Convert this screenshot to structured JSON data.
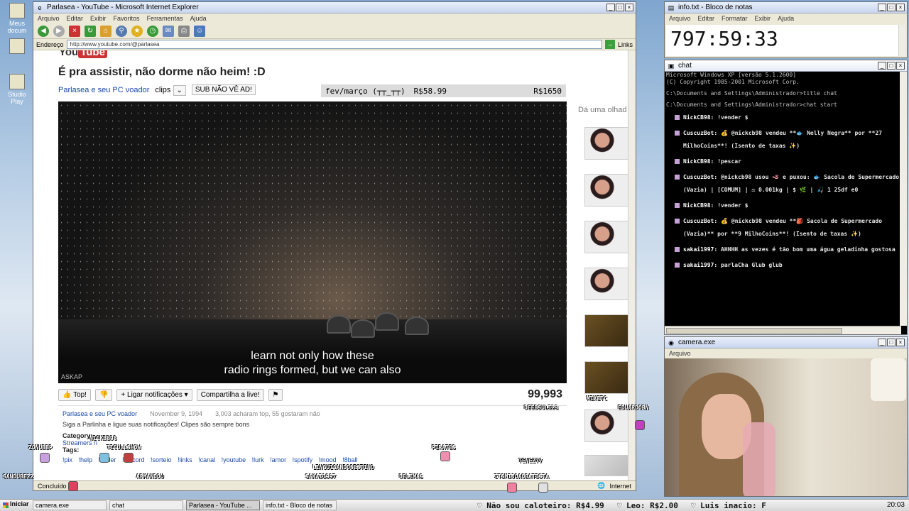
{
  "desktop": {
    "icons": [
      {
        "label": "Meus docum",
        "icon": "folder-icon"
      },
      {
        "label": "",
        "icon": "recycle-bin-icon"
      },
      {
        "label": "Studio Play",
        "icon": "app-icon"
      }
    ]
  },
  "ie": {
    "title": "Parlasea - YouTube - Microsoft Internet Explorer",
    "menu": [
      "Arquivo",
      "Editar",
      "Exibir",
      "Favoritos",
      "Ferramentas",
      "Ajuda"
    ],
    "address_label": "Endereço",
    "address": "http://www.youtube.com/@parlasea",
    "links_label": "Links",
    "status": {
      "left": "Concluído",
      "right": "Internet"
    }
  },
  "youtube": {
    "logo_a": "You",
    "logo_b": "Tube",
    "video_title": "É pra assistir, não dorme não heim! :D",
    "channel": "Parlasea e seu PC voador",
    "clips_label": "clips",
    "sub_label": "SUB NÃO VÊ AD!",
    "price_banner": {
      "label": "fev/março (┬┬_┬┬)",
      "price1": "R$58.99",
      "price2": "R$1650"
    },
    "caption_line1": "learn not only how these",
    "caption_line2": "radio rings formed, but we can also",
    "watermark": "ASKAP",
    "actions": {
      "like": "Top!",
      "notify": "Ligar notificações",
      "share": "Compartilha a live!"
    },
    "views": "99,993",
    "desc": {
      "channel": "Parlasea e seu PC voador",
      "date": "November 9, 1994",
      "likes": "3,003 acharam top, 55 gostaram não",
      "text": "Siga a Parlinha e ligue suas notificações! Clipes são sempre bons",
      "category_label": "Category:",
      "category_value": "Streamers n",
      "tags_label": "Tags:",
      "tags": "!pix !help !tinder !discord !sorteio !links !canal !youtube !lurk !amor !spotify !mood !8ball"
    },
    "related_title": "Dá uma olhad"
  },
  "overlay_names": [
    "ZONUBBP",
    "NICKBB98",
    "TICULLSHOW",
    "SANDUBE22",
    "ARMANDOU",
    "SAKAI1997",
    "LINGUICANDOSESTINO",
    "DELIMAS",
    "ITSMIJOAOBATISTA",
    "PIRATES",
    "TENEZ77",
    "DEEBSULI23",
    "MIXETC",
    "EDUARDOBN"
  ],
  "notepad": {
    "title": "info.txt - Bloco de notas",
    "menu": [
      "Arquivo",
      "Editar",
      "Formatar",
      "Exibir",
      "Ajuda"
    ],
    "content": "797:59:33"
  },
  "chat": {
    "title": "chat",
    "header_lines": [
      "Microsoft Windows XP [versão 5.1.2600]",
      "(C) Copyright 1985-2001 Microsoft Corp.",
      "C:\\Documents and Settings\\Administrador>title chat",
      "C:\\Documents and Settings\\Administrador>chat start"
    ],
    "messages": [
      {
        "user": "NickCB98:",
        "text": "!vender $"
      },
      {
        "user": "CuscuzBot:",
        "text": "💰 @nickcb98 vendeu **🐟 Nelly Negra** por **27 MilhoCoins**! (Isento de taxas ✨)"
      },
      {
        "user": "NickCB98:",
        "text": "!pescar"
      },
      {
        "user": "CuscuzBot:",
        "text": "@nickcb98 usou 🪱 e puxou: 🐟 Sacola de Supermercado (Vazia) | [COMUM] | ⚖ 0.001kg | $ 🌿 | 🎣 1 25df e0"
      },
      {
        "user": "NickCB98:",
        "text": "!vender $"
      },
      {
        "user": "CuscuzBot:",
        "text": "💰 @nickcb98 vendeu **🎒 Sacola de Supermercado (Vazia)** por **9 MilhoCoins**! (Isento de taxas ✨)"
      },
      {
        "user": "sakai1997:",
        "text": "AHHHH as vezes é tão bom uma água geladinha gostosa"
      },
      {
        "user": "sakai1997:",
        "text": "parlaCha Glub glub"
      }
    ]
  },
  "camera": {
    "title": "camera.exe",
    "menu": [
      "Arquivo"
    ]
  },
  "taskbar": {
    "start": "Iniciar",
    "tasks": [
      "camera.exe",
      "chat",
      "Parlasea - YouTube ...",
      "info.txt - Bloco de notas"
    ],
    "ticker": [
      "♡ Não sou caloteiro: R$4.99",
      "♡ Leo: R$2.00",
      "♡ Luis inacio: F"
    ],
    "clock": "20:03"
  },
  "colors": {
    "accent": "#1a49a8",
    "yt_red": "#cc3333",
    "console_bg": "#000000"
  }
}
